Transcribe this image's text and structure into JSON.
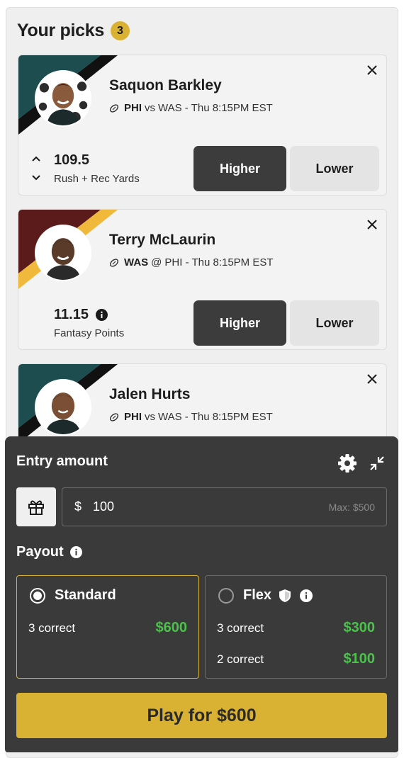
{
  "header": {
    "title": "Your picks",
    "count": "3"
  },
  "picks": [
    {
      "name": "Saquon Barkley",
      "team": "PHI",
      "separator": "vs",
      "opponent": "WAS - Thu 8:15PM EST",
      "line": "109.5",
      "stat": "Rush + Rec Yards",
      "higher_label": "Higher",
      "lower_label": "Lower",
      "colors": {
        "primary": "#1e4d4f",
        "accent": "#111111"
      }
    },
    {
      "name": "Terry McLaurin",
      "team": "WAS",
      "separator": "@",
      "opponent": "PHI - Thu 8:15PM EST",
      "line": "11.15",
      "stat": "Fantasy Points",
      "higher_label": "Higher",
      "lower_label": "Lower",
      "colors": {
        "primary": "#5c1b1b",
        "accent": "#f1b93b"
      }
    },
    {
      "name": "Jalen Hurts",
      "team": "PHI",
      "separator": "vs",
      "opponent": "WAS - Thu 8:15PM EST",
      "colors": {
        "primary": "#1e4d4f",
        "accent": "#111111"
      }
    }
  ],
  "entry": {
    "title": "Entry amount",
    "currency": "$",
    "amount": "100",
    "max_hint": "Max: $500"
  },
  "payout": {
    "title": "Payout",
    "standard": {
      "label": "Standard",
      "selected": true,
      "rows": [
        {
          "correct": "3 correct",
          "amount": "$600"
        }
      ]
    },
    "flex": {
      "label": "Flex",
      "selected": false,
      "rows": [
        {
          "correct": "3 correct",
          "amount": "$300"
        },
        {
          "correct": "2 correct",
          "amount": "$100"
        }
      ]
    }
  },
  "play_button": "Play for $600",
  "icons": {
    "close": "close-icon",
    "football": "football-icon",
    "info": "info-icon",
    "gear": "gear-icon",
    "collapse": "collapse-icon",
    "gift": "gift-icon",
    "shield": "shield-icon",
    "chevron_up": "chevron-up-icon",
    "chevron_down": "chevron-down-icon"
  },
  "colors": {
    "accent_gold": "#d9b233",
    "payout_green": "#4cc14c",
    "dark_panel": "#3a3a3a",
    "higher_button": "#3c3c3c"
  }
}
